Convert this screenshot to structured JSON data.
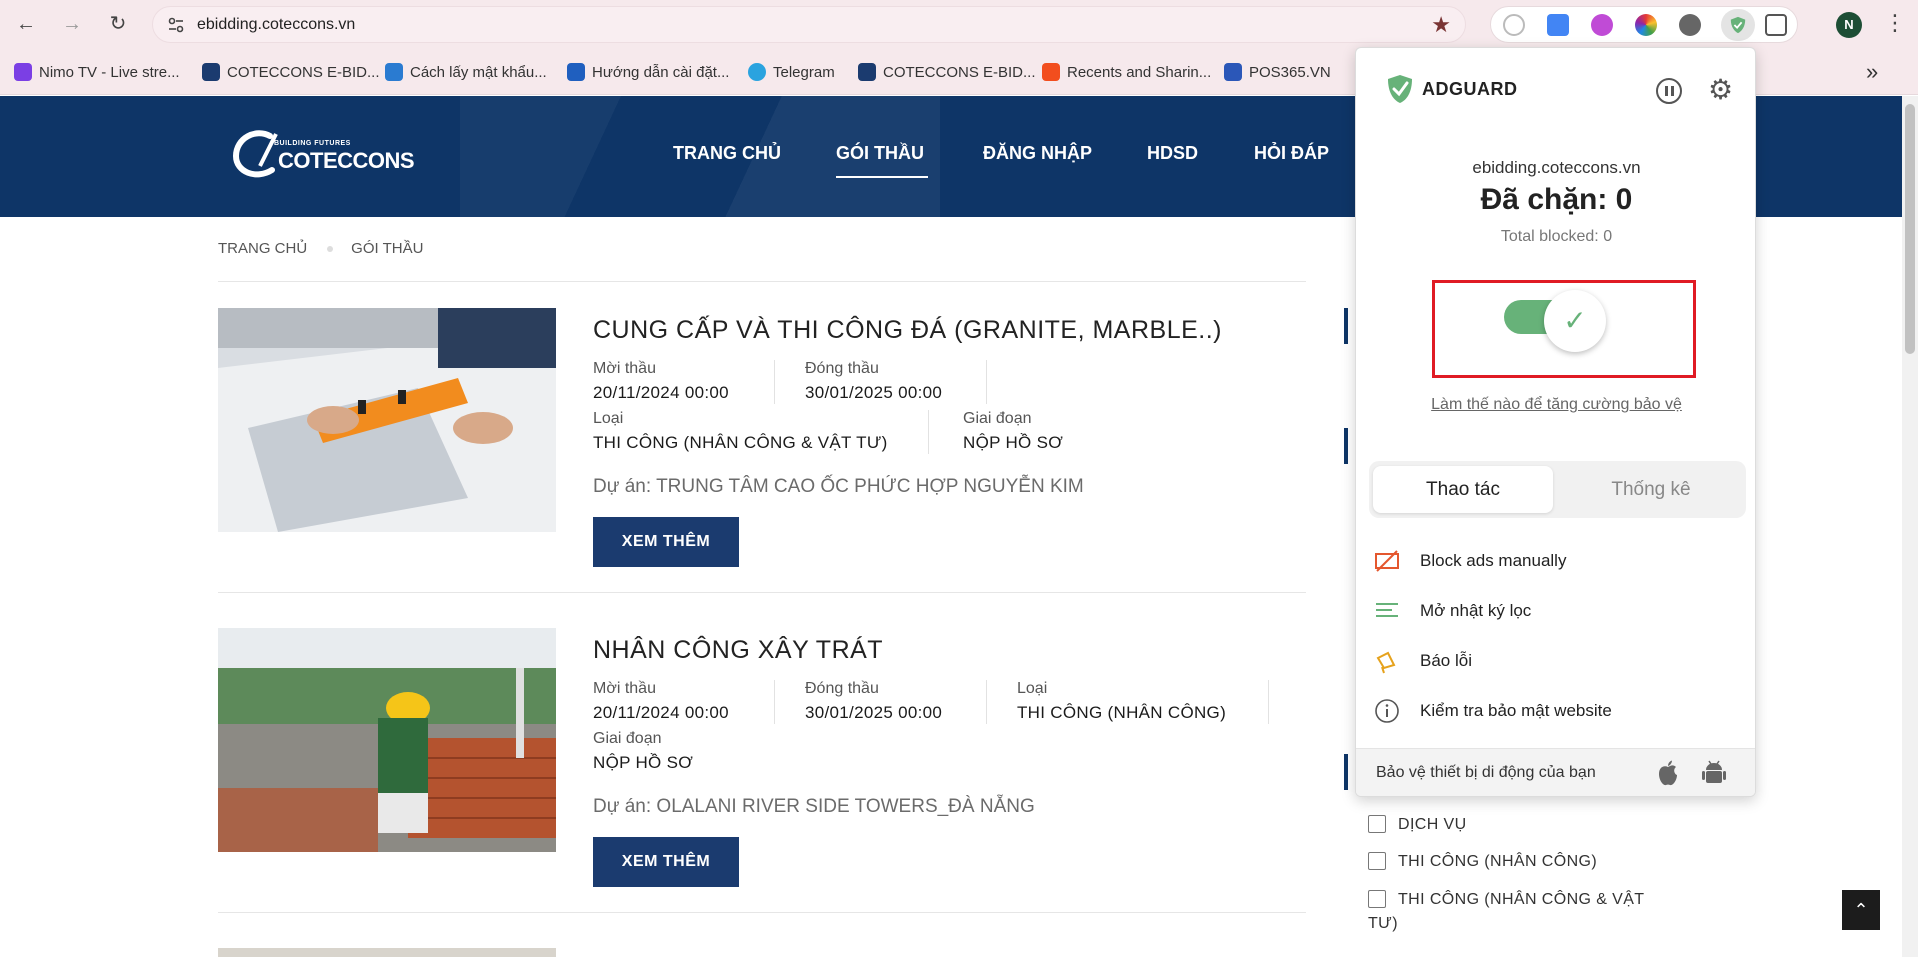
{
  "browser": {
    "url": "ebidding.coteccons.vn",
    "back_icon": "arrow-left-icon",
    "forward_icon": "arrow-right-icon",
    "reload_icon": "reload-icon",
    "profile_initial": "N",
    "bookmarks": [
      {
        "label": "Nimo TV - Live stre...",
        "color": "#7b3fe4"
      },
      {
        "label": "COTECCONS E-BID...",
        "color": "#1b3b6f"
      },
      {
        "label": "Cách lấy mật khẩu...",
        "color": "#2a7bd1"
      },
      {
        "label": "Hướng dẫn cài đặt...",
        "color": "#1f5fbf"
      },
      {
        "label": "Telegram",
        "color": "#2aa3df"
      },
      {
        "label": "COTECCONS E-BID...",
        "color": "#1b3b6f"
      },
      {
        "label": "Recents and Sharin...",
        "color": "#f24e1e"
      },
      {
        "label": "POS365.VN",
        "color": "#2b57b8"
      }
    ]
  },
  "site": {
    "logo_tagline": "BUILDING FUTURES",
    "logo_name": "COTECCONS",
    "nav": [
      "TRANG CHỦ",
      "GÓI THẦU",
      "ĐĂNG NHẬP",
      "HDSD",
      "HỎI ĐÁP"
    ],
    "breadcrumb": [
      "TRANG CHỦ",
      "GÓI THẦU"
    ],
    "cards": [
      {
        "title": "CUNG CẤP VÀ THI CÔNG ĐÁ (GRANITE, MARBLE..)",
        "moi_thau_label": "Mời thầu",
        "moi_thau": "20/11/2024 00:00",
        "dong_thau_label": "Đóng thầu",
        "dong_thau": "30/01/2025 00:00",
        "loai_label": "Loại",
        "loai": "THI CÔNG (NHÂN CÔNG & VẬT TƯ)",
        "giai_doan_label": "Giai đoạn",
        "giai_doan": "NỘP HỒ SƠ",
        "project": "Dự án: TRUNG TÂM CAO ỐC PHỨC HỢP NGUYỄN KIM",
        "button": "XEM THÊM"
      },
      {
        "title": "NHÂN CÔNG XÂY TRÁT",
        "moi_thau_label": "Mời thầu",
        "moi_thau": "20/11/2024 00:00",
        "dong_thau_label": "Đóng thầu",
        "dong_thau": "30/01/2025 00:00",
        "loai_label": "Loại",
        "loai": "THI CÔNG (NHÂN CÔNG)",
        "giai_doan_label": "Giai đoạn",
        "giai_doan": "NỘP HỒ SƠ",
        "project": "Dự án: OLALANI RIVER SIDE TOWERS_ĐÀ NẴNG",
        "button": "XEM THÊM"
      }
    ],
    "filters": [
      "DỊCH VỤ",
      "THI CÔNG (NHÂN CÔNG)",
      "THI CÔNG (NHÂN CÔNG & VẬT",
      "TƯ)"
    ],
    "scroll_top_icon": "chevron-up-icon"
  },
  "adguard": {
    "brand": "ADGUARD",
    "domain": "ebidding.coteccons.vn",
    "blocked": "Đã chặn: 0",
    "total_blocked": "Total blocked: 0",
    "protection_enabled": true,
    "protect_link": "Làm thế nào để tăng cường bảo vệ",
    "tabs": [
      "Thao tác",
      "Thống kê"
    ],
    "active_tab": "Thao tác",
    "actions": [
      {
        "label": "Block ads manually",
        "icon": "block-ads-icon"
      },
      {
        "label": "Mở nhật ký lọc",
        "icon": "filter-log-icon"
      },
      {
        "label": "Báo lỗi",
        "icon": "report-megaphone-icon"
      },
      {
        "label": "Kiểm tra bảo mật website",
        "icon": "info-icon"
      }
    ],
    "footer": "Bảo vệ thiết bị di động của bạn",
    "accent": "#67b279",
    "highlight_color": "#e01b24"
  }
}
